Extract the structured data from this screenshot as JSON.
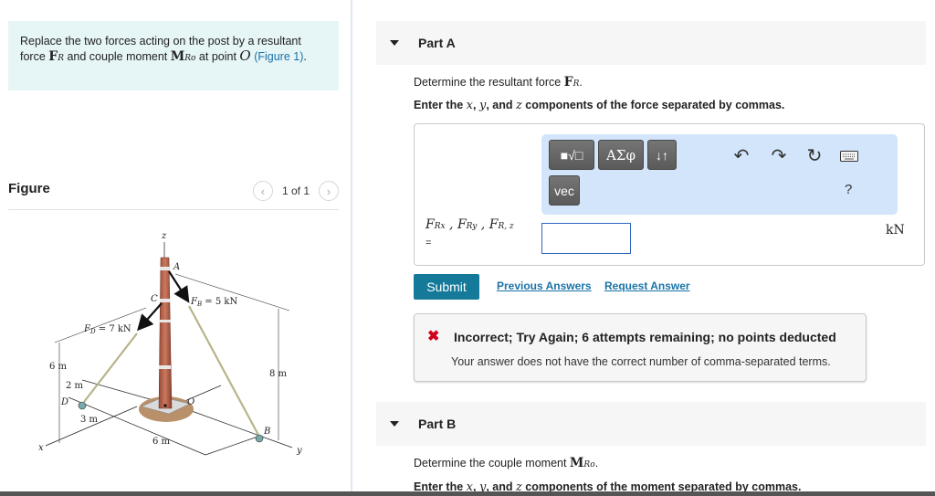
{
  "problem": {
    "text_before": "Replace the two forces acting on the post by a resultant force ",
    "force_symbol": "F",
    "force_sub": "R",
    "text_mid": " and couple moment ",
    "moment_symbol": "M",
    "moment_sub": "Ro",
    "text_after": " at point ",
    "point": "O",
    "link_text": "(Figure 1)",
    "tail": "."
  },
  "figure_panel": {
    "title": "Figure",
    "pager_text": "1 of 1",
    "prev_icon": "chevron-left-icon",
    "next_icon": "chevron-right-icon"
  },
  "diagram": {
    "labels": {
      "z": "z",
      "x": "x",
      "y": "y",
      "A": "A",
      "B": "B",
      "C": "C",
      "D": "D",
      "O": "O",
      "FB": "F",
      "FB_sub": "B",
      "FB_val": " = 5 kN",
      "FD": "F",
      "FD_sub": "D",
      "FD_val": " = 7 kN",
      "dim_6m_left": "6 m",
      "dim_2m": "2 m",
      "dim_3m": "3 m",
      "dim_6m_bottom": "6 m",
      "dim_8m": "8 m"
    }
  },
  "partA": {
    "label": "Part A",
    "q1_text": "Determine the resultant force ",
    "q1_sym": "F",
    "q1_sub": "R",
    "q2_a": "Enter the ",
    "q2_x": "x",
    "q2_b": ", ",
    "q2_y": "y",
    "q2_c": ", and ",
    "q2_z": "z",
    "q2_d": " components of the force separated by commas.",
    "toolbar": {
      "btn_templates": "■√□",
      "btn_greek": "ΑΣφ",
      "btn_arrows": "↓↑",
      "btn_vec": "vec",
      "undo_icon": "↶",
      "redo_icon": "↷",
      "reset_icon": "↻",
      "keyboard_icon": "keyboard",
      "help": "?"
    },
    "input_label": "F",
    "input_label_parts": [
      "Rx",
      "Ry",
      "R, z"
    ],
    "input_eq": "=",
    "input_value": "",
    "unit": "kN",
    "submit": "Submit",
    "previous_answers": "Previous Answers",
    "request_answer": "Request Answer",
    "feedback": {
      "icon": "✖",
      "title": "Incorrect; Try Again; 6 attempts remaining; no points deducted",
      "message": "Your answer does not have the correct number of comma-separated terms."
    }
  },
  "partB": {
    "label": "Part B",
    "q1_text": "Determine the couple moment ",
    "q1_sym": "M",
    "q1_sub": "Ro",
    "q2_a": "Enter the ",
    "q2_x": "x",
    "q2_b": ", ",
    "q2_y": "y",
    "q2_c": ", and ",
    "q2_z": "z",
    "q2_d": " components of the moment separated by commas."
  },
  "colors": {
    "accent": "#157a9a",
    "link": "#1a73a8",
    "error": "#d0021b",
    "intro_bg": "#e6f5f6",
    "toolbar_bg": "#d3e5fb"
  }
}
